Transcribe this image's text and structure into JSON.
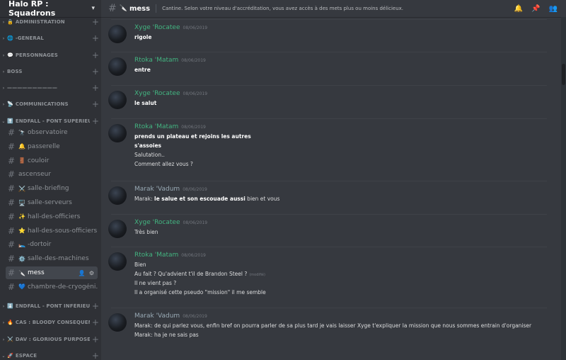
{
  "server": {
    "name": "Halo RP : Squadrons"
  },
  "categories": [
    {
      "label": "ADMINISTRATION",
      "icon": "🔒",
      "collapsed": true
    },
    {
      "label": "-GÉNÉRAL",
      "icon": "🌐",
      "collapsed": true
    },
    {
      "label": "PERSONNAGES",
      "icon": "💬",
      "collapsed": true
    },
    {
      "label": "BOSS",
      "icon": "",
      "collapsed": true
    },
    {
      "label": "——————————",
      "icon": "",
      "collapsed": true
    },
    {
      "label": "COMMUNICATIONS",
      "icon": "📡",
      "collapsed": true
    },
    {
      "label": "ENDFALL - PONT SUPÉRIEUR",
      "icon": "⬆️",
      "collapsed": false
    },
    {
      "label": "ENDFALL - PONT INFÉRIEUR",
      "icon": "⬇️",
      "collapsed": true
    },
    {
      "label": "CAS : BLOODY CONSEQUENCES",
      "icon": "🔥",
      "collapsed": true
    },
    {
      "label": "DAV : GLORIOUS PURPOSE",
      "icon": "⚔️",
      "collapsed": true
    },
    {
      "label": "ESPACE",
      "icon": "🚀",
      "collapsed": false
    }
  ],
  "channels": [
    {
      "name": "observatoire",
      "icon": "🔭"
    },
    {
      "name": "passerelle",
      "icon": "🔔"
    },
    {
      "name": "couloir",
      "icon": "🚪"
    },
    {
      "name": "ascenseur",
      "icon": ""
    },
    {
      "name": "salle-briefing",
      "icon": "⚔️"
    },
    {
      "name": "salle-serveurs",
      "icon": "🖥️"
    },
    {
      "name": "hall-des-officiers",
      "icon": "✨"
    },
    {
      "name": "hall-des-sous-officiers",
      "icon": "⭐"
    },
    {
      "name": "-dortoir",
      "icon": "🛌"
    },
    {
      "name": "salle-des-machines",
      "icon": "⚙️"
    },
    {
      "name": "mess",
      "icon": "🔪",
      "active": true
    },
    {
      "name": "chambre-de-cryogéni...",
      "icon": "💙"
    }
  ],
  "topbar": {
    "channel": "mess",
    "channel_icon": "🔪",
    "topic": "Cantine. Selon votre niveau d'accréditation, vous avez accès à des mets plus ou moins délicieux."
  },
  "messages": [
    {
      "author": "Xyge 'Rocatee",
      "color": "#43b581",
      "timestamp": "08/06/2019",
      "lines": [
        {
          "parts": [
            {
              "b": true,
              "t": "rigole"
            }
          ]
        }
      ]
    },
    {
      "author": "Rtoka 'Matam",
      "color": "#43b581",
      "timestamp": "08/06/2019",
      "lines": [
        {
          "parts": [
            {
              "b": true,
              "t": "entre"
            }
          ]
        }
      ]
    },
    {
      "author": "Xyge 'Rocatee",
      "color": "#43b581",
      "timestamp": "08/06/2019",
      "lines": [
        {
          "parts": [
            {
              "b": true,
              "t": "le salut"
            }
          ]
        }
      ]
    },
    {
      "author": "Rtoka 'Matam",
      "color": "#43b581",
      "timestamp": "08/06/2019",
      "lines": [
        {
          "parts": [
            {
              "b": true,
              "t": "prends un plateau et rejoins les autres"
            }
          ]
        },
        {
          "parts": [
            {
              "b": true,
              "t": "s'assoies"
            }
          ]
        },
        {
          "parts": [
            {
              "b": false,
              "t": "Salutation.."
            }
          ]
        },
        {
          "parts": [
            {
              "b": false,
              "t": "Comment allez vous ?"
            }
          ]
        }
      ]
    },
    {
      "author": "Marak 'Vadum",
      "color": "#99aab5",
      "timestamp": "08/06/2019",
      "lines": [
        {
          "parts": [
            {
              "b": false,
              "t": "Marak: "
            },
            {
              "b": true,
              "t": "le salue et son escouade aussi"
            },
            {
              "b": false,
              "t": " bien et vous"
            }
          ]
        }
      ]
    },
    {
      "author": "Xyge 'Rocatee",
      "color": "#43b581",
      "timestamp": "08/06/2019",
      "lines": [
        {
          "parts": [
            {
              "b": false,
              "t": "Très bien"
            }
          ]
        }
      ]
    },
    {
      "author": "Rtoka 'Matam",
      "color": "#43b581",
      "timestamp": "08/06/2019",
      "lines": [
        {
          "parts": [
            {
              "b": false,
              "t": "Bien"
            }
          ]
        },
        {
          "parts": [
            {
              "b": false,
              "t": "Au fait ? Qu'advient t'il de Brandon Steel ?"
            }
          ],
          "edited": "(modifié)"
        },
        {
          "parts": [
            {
              "b": false,
              "t": "Il ne vient pas ?"
            }
          ]
        },
        {
          "parts": [
            {
              "b": false,
              "t": "Il a organisé cette pseudo \"mission\" il me semble"
            }
          ]
        }
      ]
    },
    {
      "author": "Marak 'Vadum",
      "color": "#99aab5",
      "timestamp": "08/06/2019",
      "lines": [
        {
          "parts": [
            {
              "b": false,
              "t": "Marak: de qui parlez vous, enfin bref on pourra parler de sa plus tard je vais laisser Xyge t'expliquer la mission que nous sommes entrain d'organiser"
            }
          ]
        },
        {
          "parts": [
            {
              "b": false,
              "t": "Marak: ha je ne sais pas"
            }
          ]
        }
      ]
    }
  ]
}
